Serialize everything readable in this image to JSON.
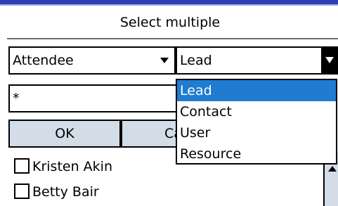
{
  "dialog": {
    "title": "Select multiple"
  },
  "filters": {
    "left_combo": {
      "value": "Attendee"
    },
    "right_combo": {
      "value": "Lead",
      "options": [
        "Lead",
        "Contact",
        "User",
        "Resource"
      ],
      "selected_index": 0
    }
  },
  "search": {
    "value": "*"
  },
  "buttons": {
    "ok_label": "OK",
    "cancel_label": "Cancel"
  },
  "list": {
    "items": [
      {
        "label": "Kristen Akin",
        "checked": false
      },
      {
        "label": "Betty Bair",
        "checked": false
      }
    ]
  },
  "colors": {
    "topbar": "#2d3fb0",
    "selection": "#1f7cd1",
    "button_bg": "#d3dde7"
  },
  "icons": {
    "combo_arrow": "chevron-down-icon",
    "scroll_up": "chevron-up-icon",
    "checkbox": "checkbox-icon"
  }
}
